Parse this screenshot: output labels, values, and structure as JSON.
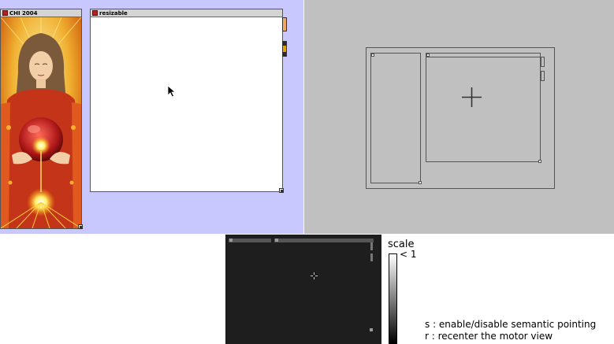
{
  "visual_view": {
    "background": "#c8c8ff",
    "window_chi": {
      "title": "CHI 2004"
    },
    "window_resizable": {
      "title": "resizable"
    },
    "close_color": "#b22222",
    "pointer_icon": "arrow-cursor-icon"
  },
  "motor_view": {
    "background": "#c0c0c0",
    "crosshair_icon": "crosshair-icon"
  },
  "overview": {
    "background": "#1e1e1e"
  },
  "legend": {
    "scale_label": "scale",
    "scale_value": "< 1",
    "hint_semantic": "s : enable/disable semantic pointing",
    "hint_recenter": "r : recenter the motor view"
  }
}
